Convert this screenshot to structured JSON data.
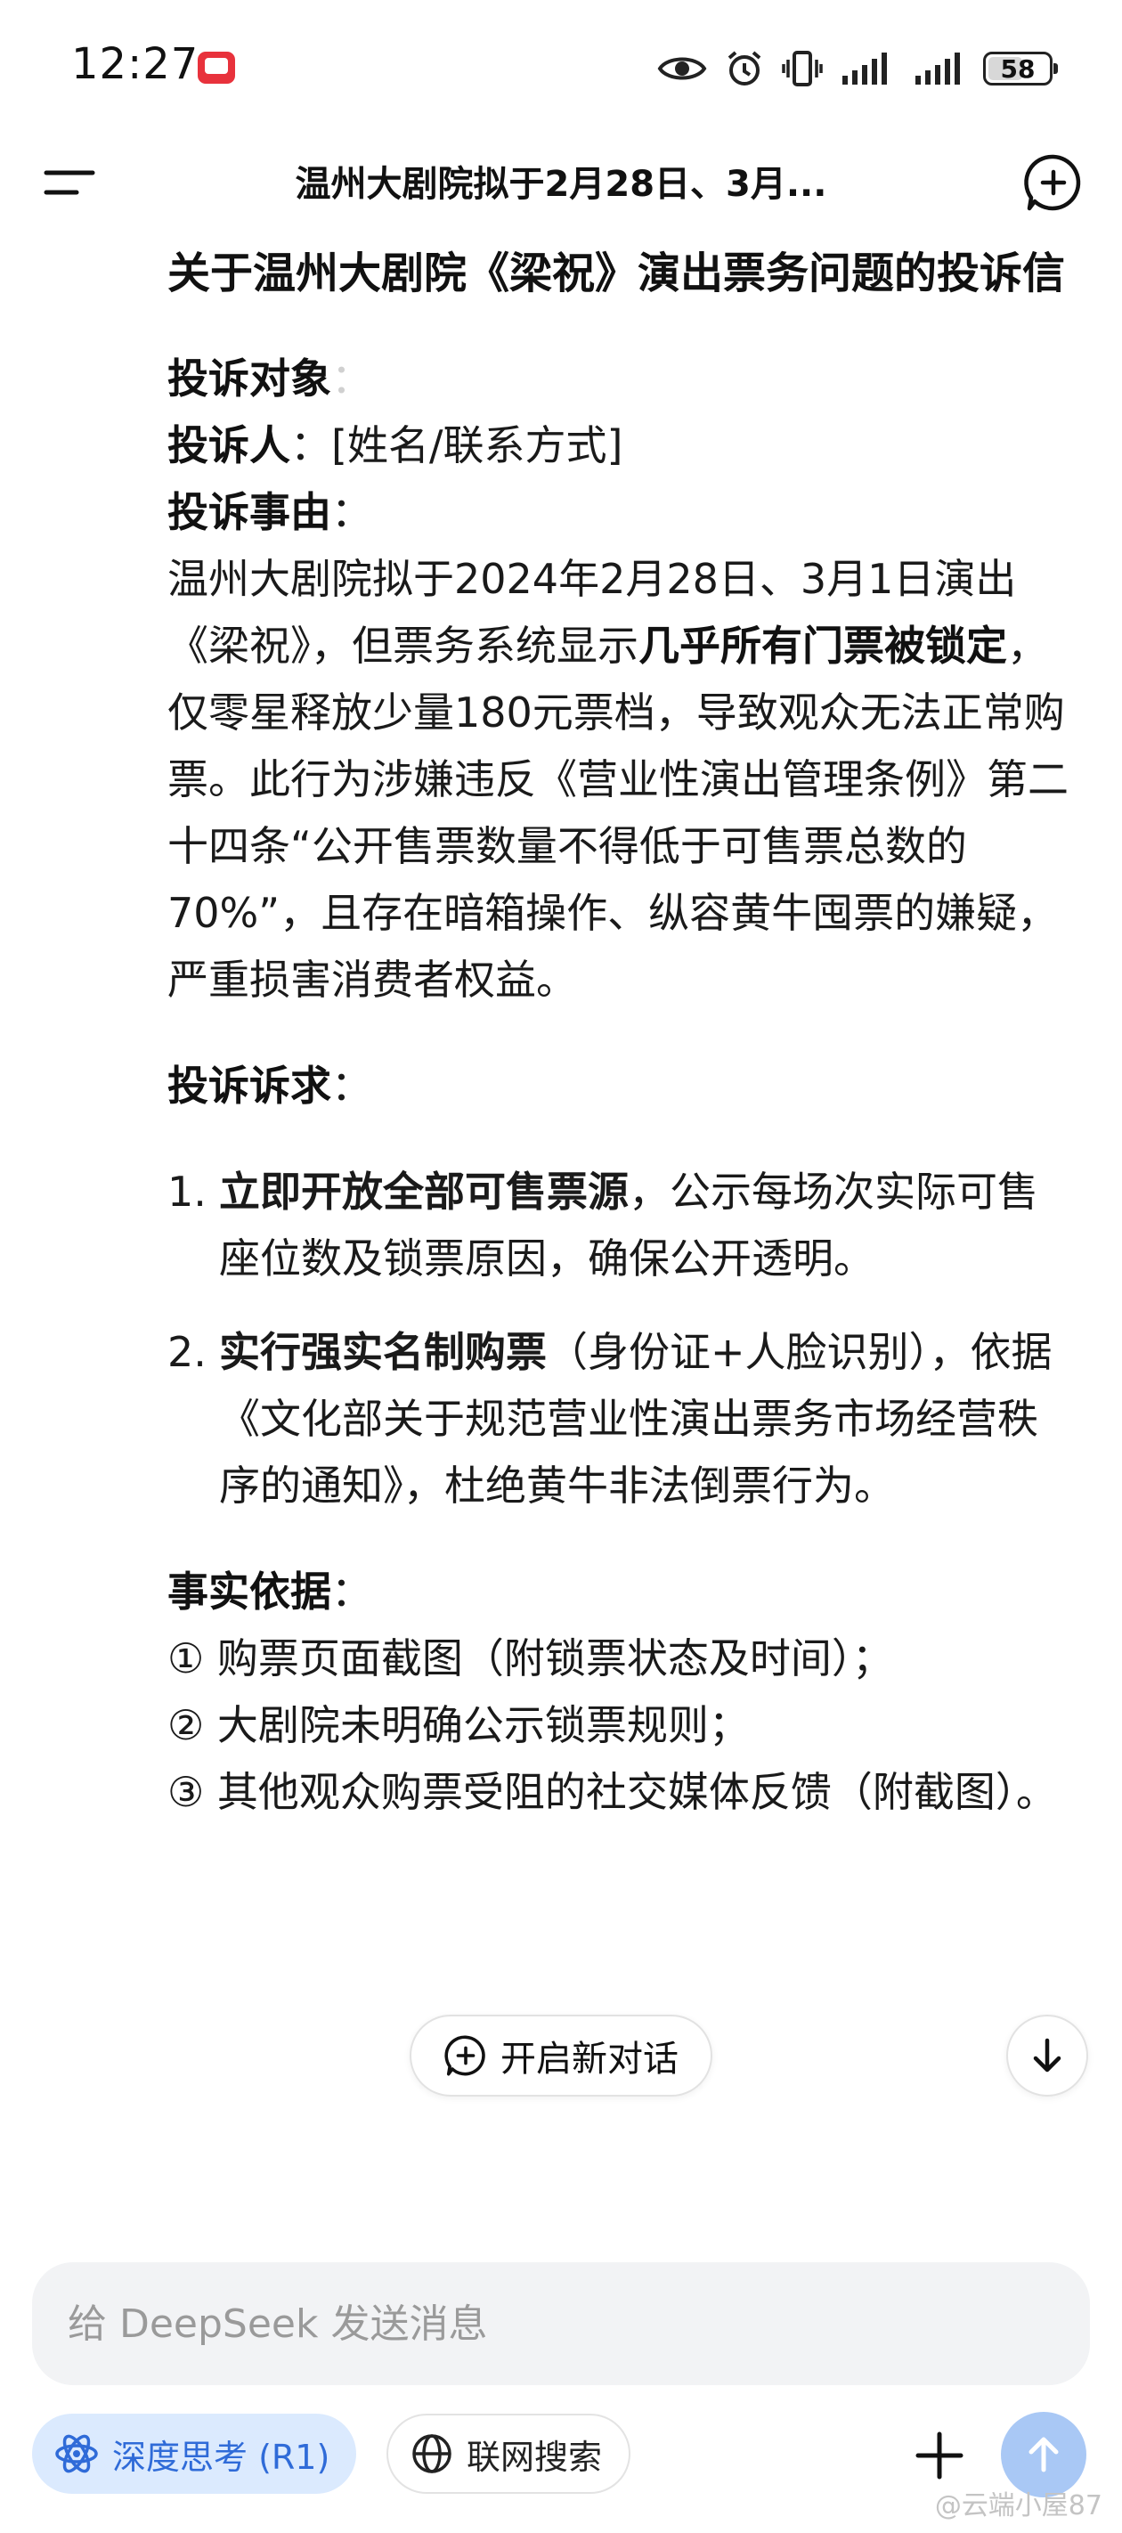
{
  "status_bar": {
    "time": "12:27",
    "battery": "58",
    "battery_level": 0.58
  },
  "header": {
    "title": "温州大剧院拟于2月28日、3月..."
  },
  "letter": {
    "title": "关于温州大剧院《梁祝》演出票务问题的投诉信",
    "target_label": "投诉对象",
    "target_value": "：",
    "complainant_label": "投诉人",
    "complainant_value": "：[姓名/联系方式]",
    "reason_label": "投诉事由",
    "reason_colon": "：",
    "reason_text_1": "温州大剧院拟于2024年2月28日、3月1日演出《梁祝》，但票务系统显示",
    "reason_bold": "几乎所有门票被锁定",
    "reason_text_2": "，仅零星释放少量180元票档，导致观众无法正常购票。此行为涉嫌违反《营业性演出管理条例》第二十四条“公开售票数量不得低于可售票总数的70%”，且存在暗箱操作、纵容黄牛囤票的嫌疑，严重损害消费者权益。",
    "demands_label": "投诉诉求",
    "demands_colon": "：",
    "demands": [
      {
        "num": "1.",
        "bold": "立即开放全部可售票源",
        "text": "，公示每场次实际可售座位数及锁票原因，确保公开透明。"
      },
      {
        "num": "2.",
        "bold": "实行强实名制购票",
        "text": "（身份证+人脸识别），依据《文化部关于规范营业性演出票务市场经营秩序的通知》，杜绝黄牛非法倒票行为。"
      }
    ],
    "evidence_label": "事实依据",
    "evidence_colon": "：",
    "evidence": [
      "① 购票页面截图（附锁票状态及时间）；",
      "② 大剧院未明确公示锁票规则；",
      "③ 其他观众购票受阻的社交媒体反馈（附截图）。"
    ]
  },
  "floating": {
    "new_chat_label": "开启新对话"
  },
  "composer": {
    "placeholder": "给 DeepSeek 发送消息",
    "deep_think_label": "深度思考 (R1)",
    "web_search_label": "联网搜索"
  },
  "watermark": "@云端小屋87",
  "colors": {
    "accent_blue": "#2f6bd8",
    "send_button": "#a9c8f5",
    "deep_think_bg": "#dbeafe",
    "input_bg": "#f2f3f5"
  },
  "icons": {
    "menu": "menu-icon",
    "new_chat": "new-chat-icon",
    "scroll_down": "arrow-down-icon",
    "deep_think": "atom-icon",
    "web_search": "globe-icon",
    "attach": "plus-icon",
    "send": "arrow-up-icon"
  }
}
